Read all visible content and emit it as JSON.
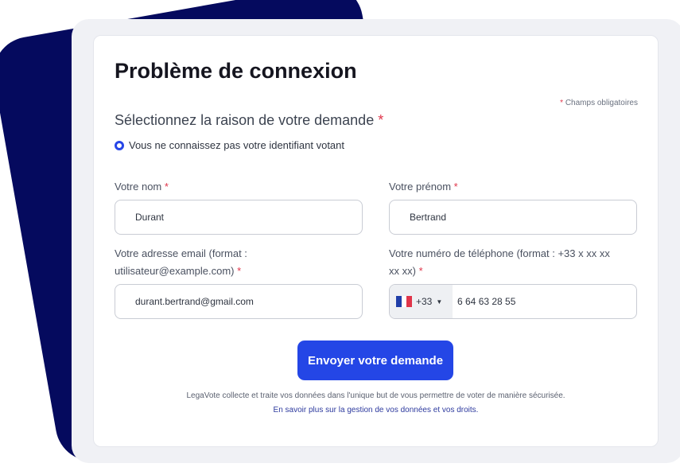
{
  "title": "Problème de connexion",
  "required_note": "Champs obligatoires",
  "required_star": "*",
  "reason": {
    "label": "Sélectionnez la raison de votre demande",
    "selected_option": "Vous ne connaissez pas votre identifiant votant"
  },
  "fields": {
    "last_name": {
      "label": "Votre nom",
      "value": "Durant"
    },
    "first_name": {
      "label": "Votre prénom",
      "value": "Bertrand"
    },
    "email": {
      "label_line1": "Votre adresse email (format :",
      "label_line2": "utilisateur@example.com)",
      "value": "durant.bertrand@gmail.com"
    },
    "phone": {
      "label_line1": "Votre numéro de téléphone (format : +33 x xx xx",
      "label_line2": "xx xx)",
      "country_code": "+33",
      "value": "6 64 63 28 55"
    }
  },
  "submit_label": "Envoyer votre demande",
  "footer": {
    "notice": "LegaVote collecte et traite vos données dans l'unique but de vous permettre de voter de manière sécurisée.",
    "link": "En savoir plus sur la gestion de vos données et vos droits."
  },
  "colors": {
    "primary": "#2446e6",
    "backdrop": "#050a5e",
    "required": "#e0354a"
  },
  "icons": {
    "flag": "france-flag-icon",
    "caret": "caret-down-icon"
  }
}
